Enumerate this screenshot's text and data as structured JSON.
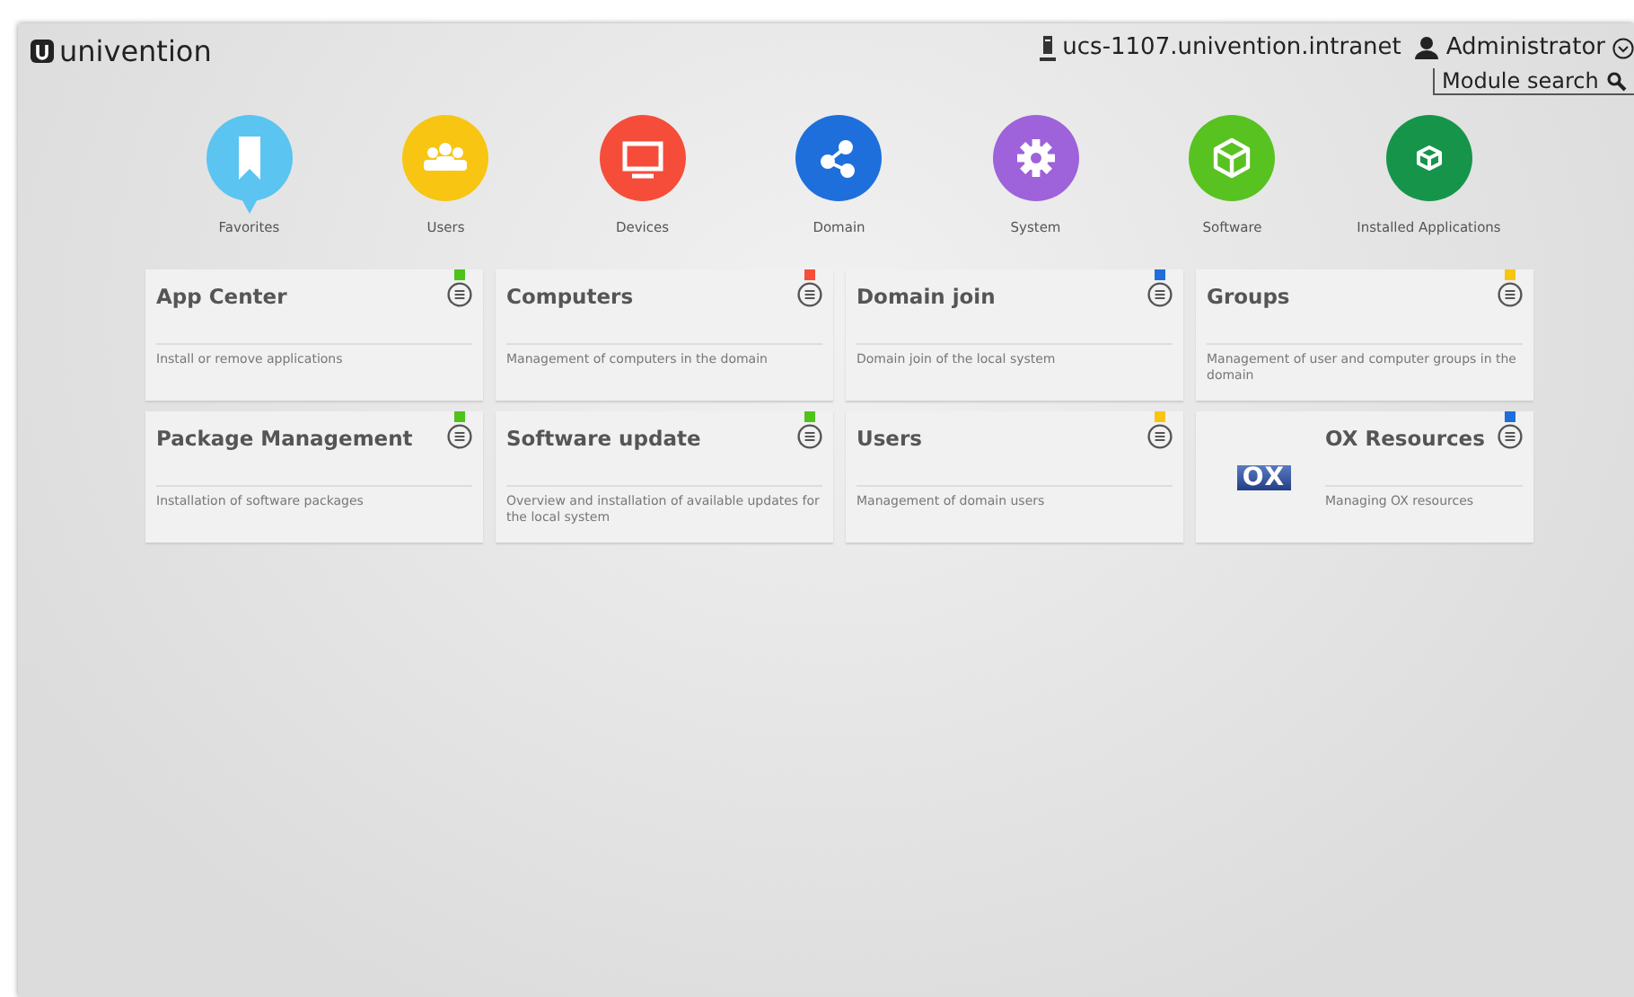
{
  "header": {
    "logo": "univention",
    "host": "ucs-1107.univention.intranet",
    "user": "Administrator",
    "search": {
      "placeholder": "Module search"
    }
  },
  "categories": [
    {
      "label": "Favorites",
      "kind": "bookmark",
      "color": "#5bc4f0"
    },
    {
      "label": "Users",
      "kind": "users",
      "color": "#f8c512"
    },
    {
      "label": "Devices",
      "kind": "monitor",
      "color": "#f54d3a"
    },
    {
      "label": "Domain",
      "kind": "share",
      "color": "#1e6fdb"
    },
    {
      "label": "System",
      "kind": "gear",
      "color": "#9e62db"
    },
    {
      "label": "Software",
      "kind": "cube",
      "color": "#58c221"
    },
    {
      "label": "Installed Applications",
      "kind": "smallcube",
      "color": "#16954a"
    }
  ],
  "modules": [
    {
      "title": "App Center",
      "description": "Install or remove applications",
      "color": "#4fc21c"
    },
    {
      "title": "Computers",
      "description": "Management of computers in the domain",
      "color": "#f54d3a"
    },
    {
      "title": "Domain join",
      "description": "Domain join of the local system",
      "color": "#1e6fdb"
    },
    {
      "title": "Groups",
      "description": "Management of user and computer groups in the domain",
      "color": "#f8c512"
    },
    {
      "title": "Package Management",
      "description": "Installation of software packages",
      "color": "#4fc21c"
    },
    {
      "title": "Software update",
      "description": "Overview and installation of available updates for the local system",
      "color": "#4fc21c"
    },
    {
      "title": "Users",
      "description": "Management of domain users",
      "color": "#f8c512"
    },
    {
      "title": "OX Resources",
      "description": "Managing OX resources",
      "color": "#1e6fdb",
      "logo": "OX"
    }
  ]
}
